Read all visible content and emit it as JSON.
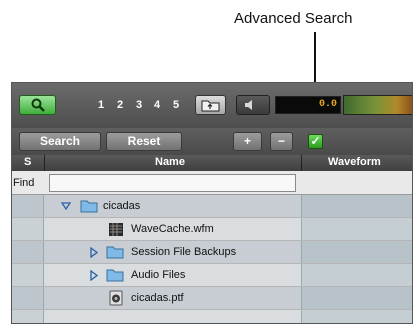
{
  "callout": {
    "label": "Advanced Search"
  },
  "toolbar": {
    "numbers": [
      "1",
      "2",
      "3",
      "4",
      "5"
    ],
    "counter": "0.0",
    "search_label": "Search",
    "reset_label": "Reset",
    "plus_label": "+",
    "minus_label": "−",
    "advanced_search_checked": true
  },
  "table": {
    "headers": {
      "s": "S",
      "name": "Name",
      "waveform": "Waveform"
    },
    "find_label": "Find",
    "find_value": "",
    "rows": [
      {
        "name": "cicadas",
        "icon": "folder-icon",
        "expanded": true
      },
      {
        "name": "WaveCache.wfm",
        "icon": "wavecache-file-icon"
      },
      {
        "name": "Session File Backups",
        "icon": "folder-icon",
        "expanded": false
      },
      {
        "name": "Audio Files",
        "icon": "folder-icon",
        "expanded": false
      },
      {
        "name": "cicadas.ptf",
        "icon": "session-file-icon"
      }
    ]
  },
  "colors": {
    "accent_green": "#3fae3c",
    "counter_amber": "#e6a420",
    "folder_blue": "#7fb9e8"
  }
}
